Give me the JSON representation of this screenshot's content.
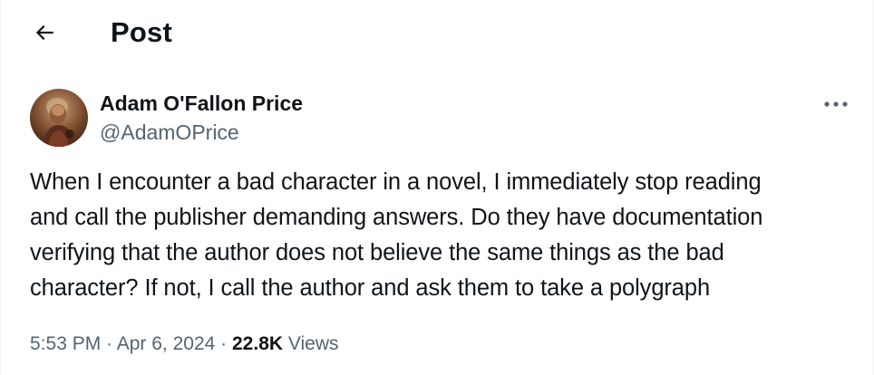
{
  "header": {
    "back_icon": "arrow-left-icon",
    "title": "Post"
  },
  "post": {
    "author": {
      "display_name": "Adam O'Fallon Price",
      "handle": "@AdamOPrice",
      "avatar": "profile-photo"
    },
    "more_icon": "more-horizontal-icon",
    "text": "When I encounter a bad character in a novel, I immediately stop reading\nand call the publisher demanding answers. Do they have documentation\nverifying that the author does not believe the same things as the bad\ncharacter? If not, I call the author and ask them to take a polygraph",
    "meta": {
      "time": "5:53 PM",
      "separator": " · ",
      "date": "Apr 6, 2024",
      "views_count": "22.8K",
      "views_label": "Views"
    }
  },
  "colors": {
    "text_primary": "#0f1419",
    "text_secondary": "#536471",
    "border": "#eff3f4"
  }
}
